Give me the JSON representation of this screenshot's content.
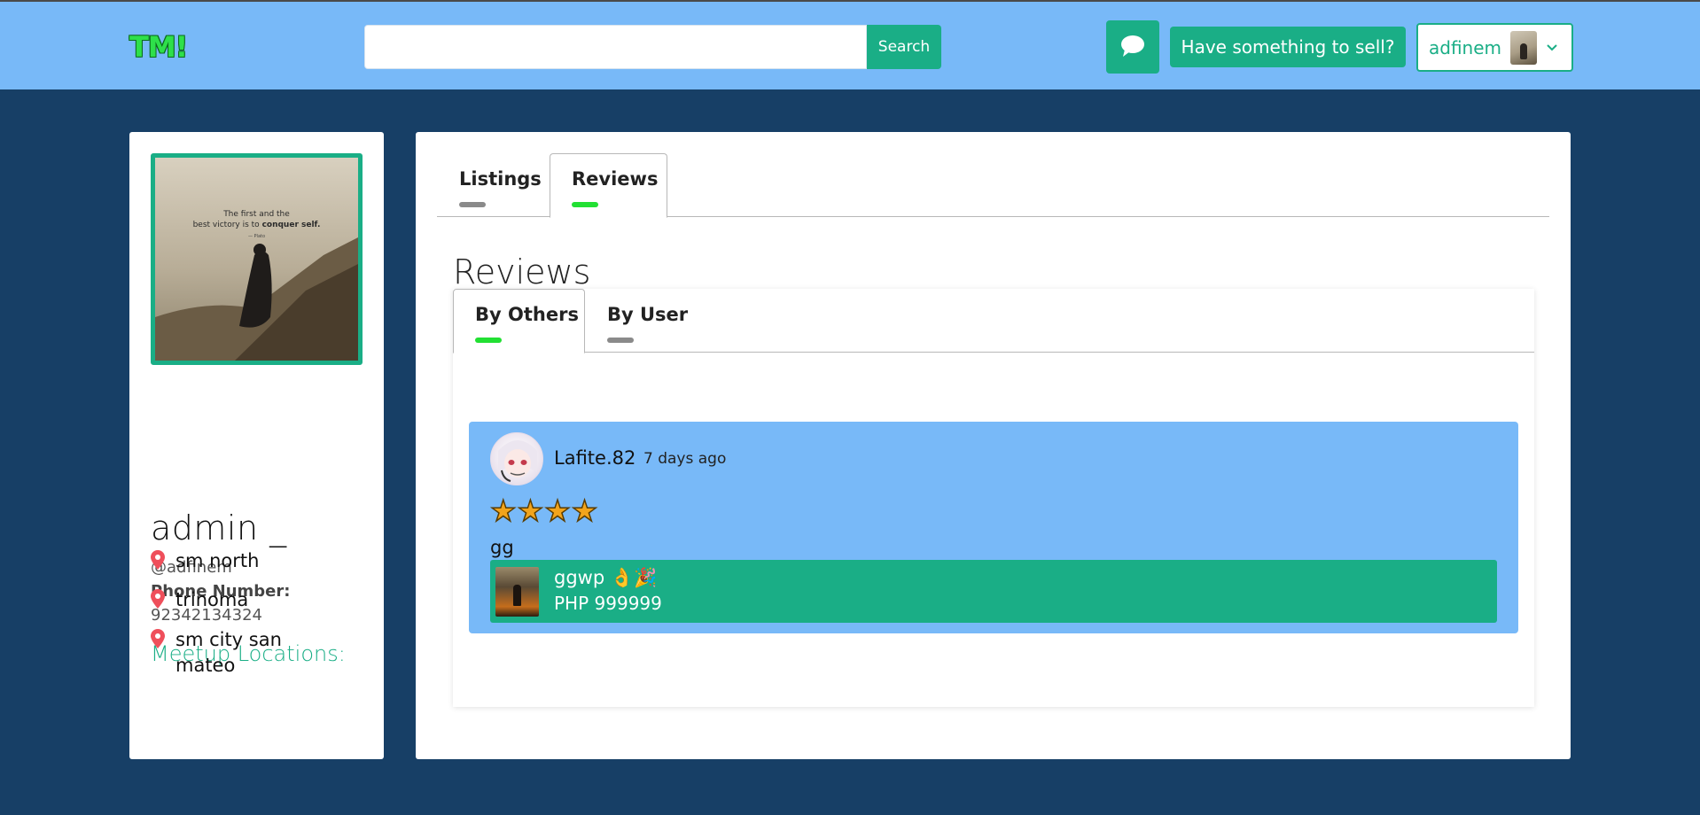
{
  "header": {
    "logo": "TM!",
    "search": {
      "value": "",
      "placeholder": "",
      "button_label": "Search"
    },
    "chat_icon": "chat-bubble-icon",
    "sell_button_label": "Have something to sell?",
    "user_menu": {
      "username": "adfinem",
      "dropdown_icon": "chevron-down-icon"
    }
  },
  "profile": {
    "image_quote_line1": "The first and the",
    "image_quote_line2_prefix": "best victory is to ",
    "image_quote_line2_bold": "conquer self.",
    "image_quote_sig": "— Plato",
    "name": "admin _",
    "handle": "@adfinem",
    "phone_label": "Phone Number:",
    "phone": "92342134324",
    "meetup_title": "Meetup Locations:",
    "locations": [
      "sm north",
      "trinoma",
      "sm city san mateo"
    ]
  },
  "main": {
    "tabs": [
      {
        "label": "Listings",
        "active": false
      },
      {
        "label": "Reviews",
        "active": true
      }
    ],
    "section_title": "Reviews",
    "subtabs": [
      {
        "label": "By Others",
        "active": true
      },
      {
        "label": "By User",
        "active": false
      }
    ],
    "reviews": [
      {
        "reviewer": "Lafite.82",
        "time": "7 days ago",
        "rating": 4,
        "text": "gg",
        "listing": {
          "title": "ggwp 👌🎉",
          "price": "PHP 999999"
        }
      }
    ]
  },
  "colors": {
    "header_bg": "#78b9f8",
    "page_bg": "#173f66",
    "accent": "#1aae86",
    "active_tab_indicator": "#22e033",
    "inactive_tab_indicator": "#8a8a8a",
    "review_bg": "#78b9f8",
    "star": "#f2a41c"
  }
}
